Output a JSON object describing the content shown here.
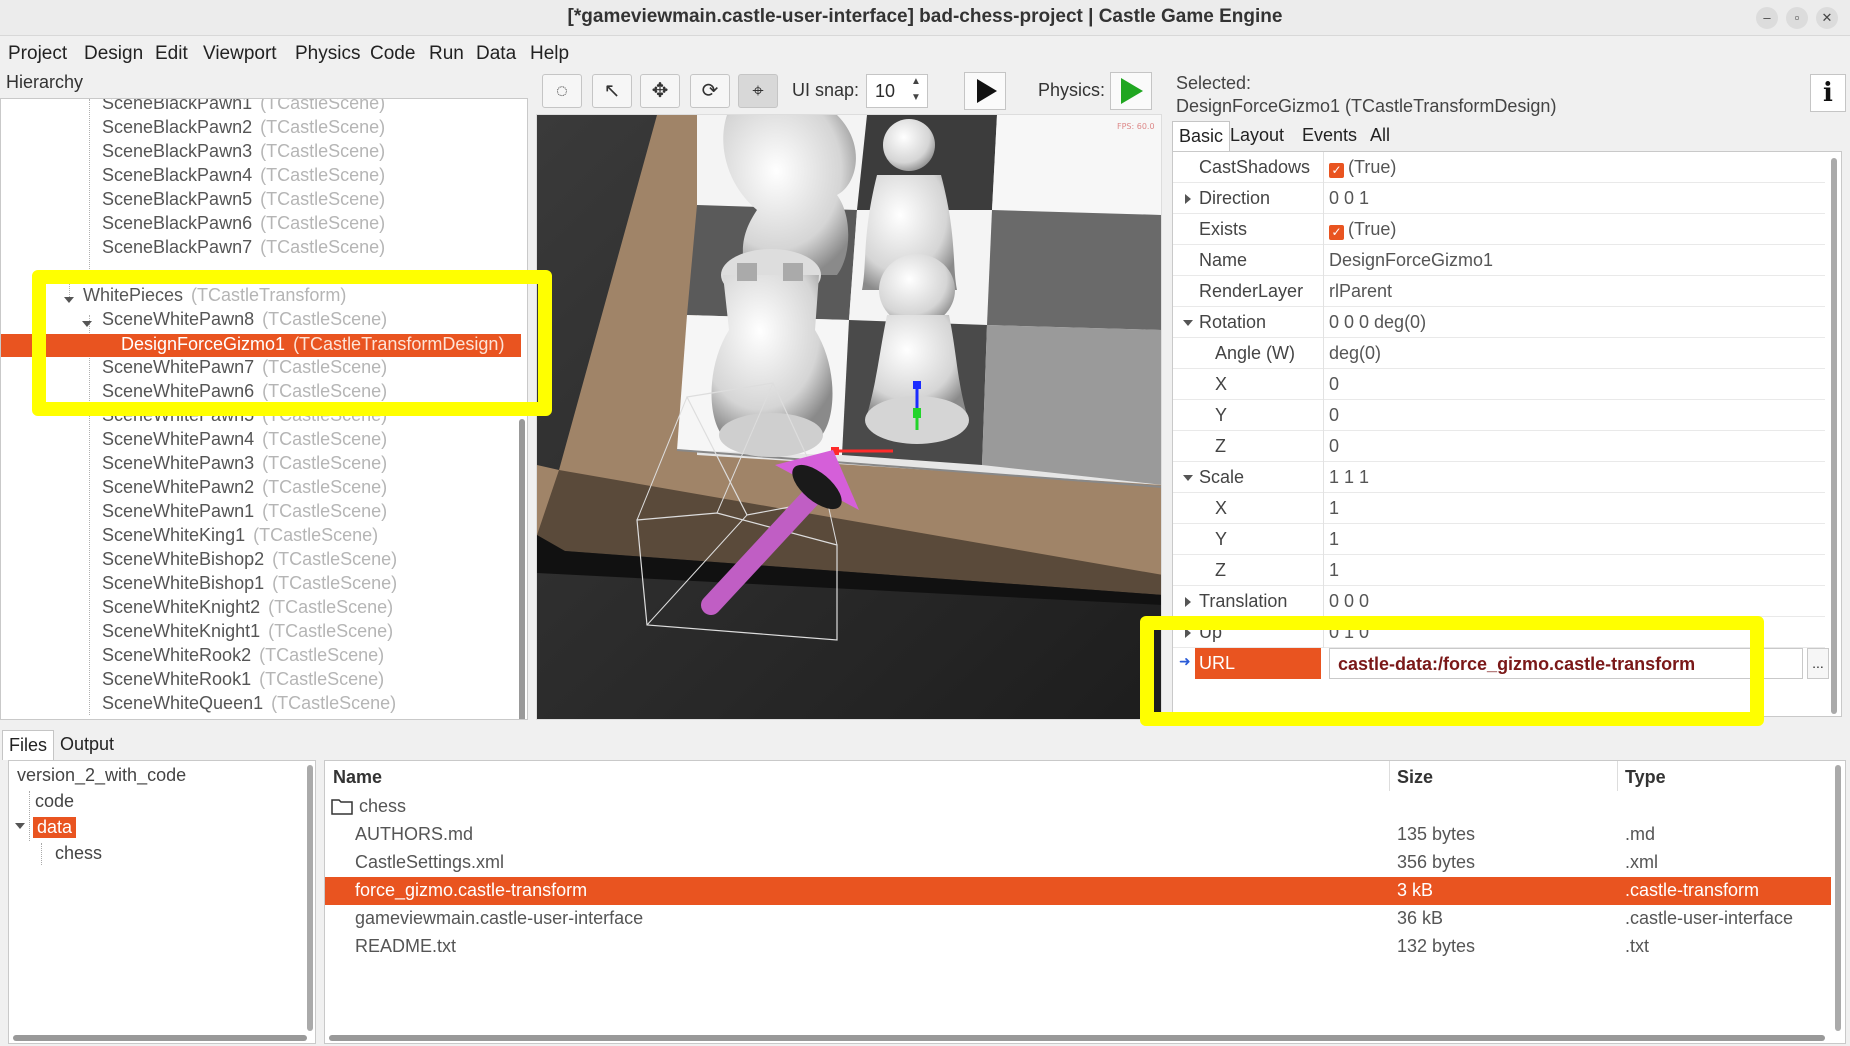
{
  "window": {
    "title": "[*gameviewmain.castle-user-interface] bad-chess-project | Castle Game Engine"
  },
  "menu": [
    "Project",
    "Design",
    "Edit",
    "Viewport",
    "Physics",
    "Code",
    "Run",
    "Data",
    "Help"
  ],
  "hierarchy": {
    "label": "Hierarchy",
    "items": [
      {
        "name": "SceneBlackPawn1",
        "type": "(TCastleScene)"
      },
      {
        "name": "SceneBlackPawn2",
        "type": "(TCastleScene)"
      },
      {
        "name": "SceneBlackPawn3",
        "type": "(TCastleScene)"
      },
      {
        "name": "SceneBlackPawn4",
        "type": "(TCastleScene)"
      },
      {
        "name": "SceneBlackPawn5",
        "type": "(TCastleScene)"
      },
      {
        "name": "SceneBlackPawn6",
        "type": "(TCastleScene)"
      },
      {
        "name": "SceneBlackPawn7",
        "type": "(TCastleScene)"
      },
      {
        "name": "WhitePieces",
        "type": "(TCastleTransform)"
      },
      {
        "name": "SceneWhitePawn8",
        "type": "(TCastleScene)"
      },
      {
        "name": "DesignForceGizmo1",
        "type": "(TCastleTransformDesign)"
      },
      {
        "name": "SceneWhitePawn7",
        "type": "(TCastleScene)"
      },
      {
        "name": "SceneWhitePawn6",
        "type": "(TCastleScene)"
      },
      {
        "name": "SceneWhitePawn5",
        "type": "(TCastleScene)"
      },
      {
        "name": "SceneWhitePawn4",
        "type": "(TCastleScene)"
      },
      {
        "name": "SceneWhitePawn3",
        "type": "(TCastleScene)"
      },
      {
        "name": "SceneWhitePawn2",
        "type": "(TCastleScene)"
      },
      {
        "name": "SceneWhitePawn1",
        "type": "(TCastleScene)"
      },
      {
        "name": "SceneWhiteKing1",
        "type": "(TCastleScene)"
      },
      {
        "name": "SceneWhiteBishop2",
        "type": "(TCastleScene)"
      },
      {
        "name": "SceneWhiteBishop1",
        "type": "(TCastleScene)"
      },
      {
        "name": "SceneWhiteKnight2",
        "type": "(TCastleScene)"
      },
      {
        "name": "SceneWhiteKnight1",
        "type": "(TCastleScene)"
      },
      {
        "name": "SceneWhiteRook2",
        "type": "(TCastleScene)"
      },
      {
        "name": "SceneWhiteRook1",
        "type": "(TCastleScene)"
      },
      {
        "name": "SceneWhiteQueen1",
        "type": "(TCastleScene)"
      }
    ]
  },
  "toolbar": {
    "ui_snap_label": "UI snap:",
    "ui_snap_value": "10",
    "physics_label": "Physics:"
  },
  "inspector": {
    "selected_label": "Selected:",
    "selected_value": "DesignForceGizmo1 (TCastleTransformDesign)",
    "info_label": "i",
    "tabs": [
      "Basic",
      "Layout",
      "Events",
      "All"
    ],
    "properties": [
      {
        "name": "CastShadows",
        "value": "(True)"
      },
      {
        "name": "Direction",
        "value": "0 0 1"
      },
      {
        "name": "Exists",
        "value": "(True)"
      },
      {
        "name": "Name",
        "value": "DesignForceGizmo1"
      },
      {
        "name": "RenderLayer",
        "value": "rlParent"
      },
      {
        "name": "Rotation",
        "value": "0 0 0 deg(0)"
      },
      {
        "name": "Angle (W)",
        "value": "deg(0)"
      },
      {
        "name": "X",
        "value": "0"
      },
      {
        "name": "Y",
        "value": "0"
      },
      {
        "name": "Z",
        "value": "0"
      },
      {
        "name": "Scale",
        "value": "1 1 1"
      },
      {
        "name": "X",
        "value": "1"
      },
      {
        "name": "Y",
        "value": "1"
      },
      {
        "name": "Z",
        "value": "1"
      },
      {
        "name": "Translation",
        "value": "0 0 0"
      },
      {
        "name": "Up",
        "value": "0 1 0"
      }
    ],
    "url": {
      "name": "URL",
      "value": "castle-data:/force_gizmo.castle-transform",
      "button": "..."
    }
  },
  "bottom": {
    "tabs": [
      "Files",
      "Output"
    ],
    "tree": [
      "version_2_with_code",
      "code",
      "data",
      "chess"
    ],
    "columns": [
      "Name",
      "Size",
      "Type"
    ],
    "folder": "chess",
    "files": [
      {
        "name": "AUTHORS.md",
        "size": "135 bytes",
        "type": ".md"
      },
      {
        "name": "CastleSettings.xml",
        "size": "356 bytes",
        "type": ".xml"
      },
      {
        "name": "force_gizmo.castle-transform",
        "size": "3 kB",
        "type": ".castle-transform"
      },
      {
        "name": "gameviewmain.castle-user-interface",
        "size": "36 kB",
        "type": ".castle-user-interface"
      },
      {
        "name": "README.txt",
        "size": "132 bytes",
        "type": ".txt"
      }
    ]
  },
  "viewport": {
    "fps_text": "FPS: 60.0"
  },
  "colors": {
    "accent": "#e95420",
    "highlight": "#ffff00",
    "gizmo": "#d55fd9"
  }
}
